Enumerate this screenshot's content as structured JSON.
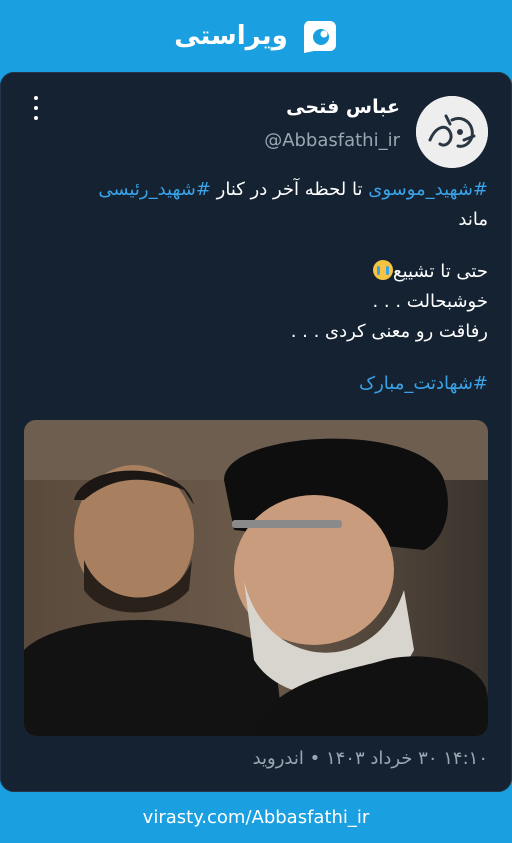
{
  "brand": {
    "name": "ویراستی",
    "logo_icon": "virasty-logo-icon"
  },
  "author": {
    "name": "عباس فتحی",
    "handle": "@Abbasfathi_ir",
    "avatar_icon": "calligraphy-avatar-icon"
  },
  "menu_icon": "kebab-menu-icon",
  "post": {
    "line1_hashtag_a": "#شهید_موسوی",
    "line1_text": " تا لحظه آخر در کنار ",
    "line1_hashtag_b": "#شهید_رئیسی",
    "line2": "ماند",
    "line3_text": "حتی تا تشییع",
    "line3_emoji": "loudly-crying-face-icon",
    "line4": "خوشبحالت . . .",
    "line5": "رفاقت رو معنی کردی . . .",
    "line6_hashtag": "#شهادتت_مبارک"
  },
  "timestamp": "۱۴:۱۰ ۳۰ خرداد ۱۴۰۳ • اندروید",
  "footer": {
    "link": "virasty.com/Abbasfathi_ir"
  },
  "colors": {
    "background": "#1a9fe0",
    "card": "#152232",
    "hashtag": "#3aa3e8",
    "muted": "#9aa6b2"
  }
}
